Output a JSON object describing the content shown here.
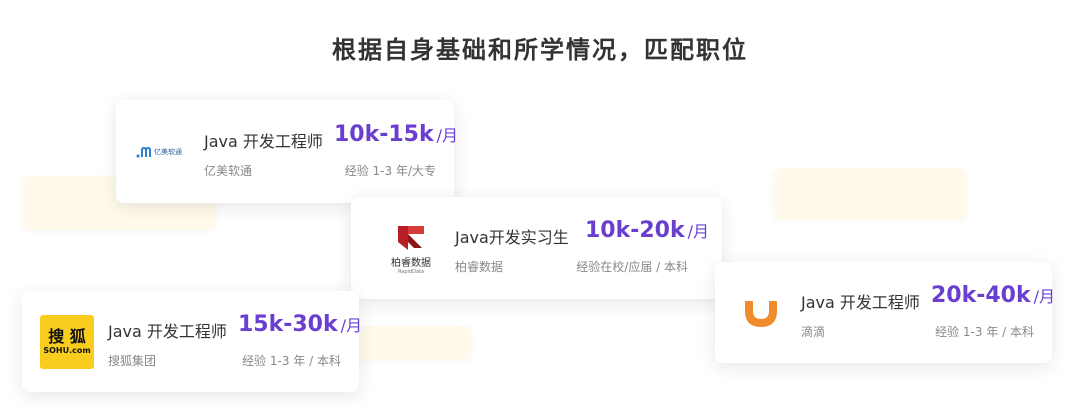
{
  "heading": "根据自身基础和所学情况，匹配职位",
  "colors": {
    "accent": "#6a3fd0",
    "deco": "#fffaec",
    "didi_orange": "#f08c2c",
    "sohu_yellow": "#f8cd1e",
    "brainsoft_red": "#c0282c"
  },
  "cards": [
    {
      "title": "Java 开发工程师",
      "salary": "10k-15k",
      "unit": "/月",
      "company": "亿美软通",
      "requirement": "经验 1-3 年/大专",
      "logo_text": "亿美软通"
    },
    {
      "title": "Java开发实习生",
      "salary": "10k-20k",
      "unit": "/月",
      "company": "柏睿数据",
      "requirement": "经验在校/应届 / 本科",
      "logo_text": "柏睿数据",
      "logo_subtext": "RapidData"
    },
    {
      "title": "Java 开发工程师",
      "salary": "15k-30k",
      "unit": "/月",
      "company": "搜狐集团",
      "requirement": "经验 1-3 年 / 本科",
      "logo_text_top": "搜 狐",
      "logo_text_bottom": "SOHU.com"
    },
    {
      "title": "Java 开发工程师",
      "salary": "20k-40k",
      "unit": "/月",
      "company": "滴滴",
      "requirement": "经验 1-3 年 / 本科"
    }
  ]
}
